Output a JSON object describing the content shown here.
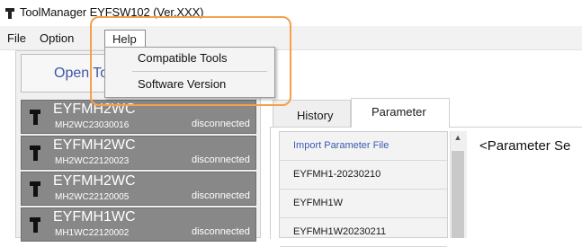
{
  "window": {
    "title": "ToolManager EYFSW102 (Ver.XXX)"
  },
  "menu": {
    "file": "File",
    "option": "Option",
    "help": "Help",
    "help_items": [
      "Compatible Tools",
      "Software Version"
    ]
  },
  "sidebar": {
    "open_tool_label": "Open Tool",
    "tools": [
      {
        "name": "EYFMH2WC",
        "serial": "MH2WC23030016",
        "status": "disconnected"
      },
      {
        "name": "EYFMH2WC",
        "serial": "MH2WC22120023",
        "status": "disconnected"
      },
      {
        "name": "EYFMH2WC",
        "serial": "MH2WC22120005",
        "status": "disconnected"
      },
      {
        "name": "EYFMH1WC",
        "serial": "MH1WC22120002",
        "status": "disconnected"
      }
    ]
  },
  "tabs": {
    "history": "History",
    "parameter": "Parameter"
  },
  "parameter_list": {
    "items": [
      "Import Parameter File",
      "EYFMH1-20230210",
      "EYFMH1W",
      "EYFMH1W20230211"
    ]
  },
  "parameter_panel": {
    "heading": "<Parameter Se"
  },
  "colors": {
    "highlight": "#f5a04a",
    "tool_card": "#888888",
    "link_blue": "#3a5bb0"
  }
}
